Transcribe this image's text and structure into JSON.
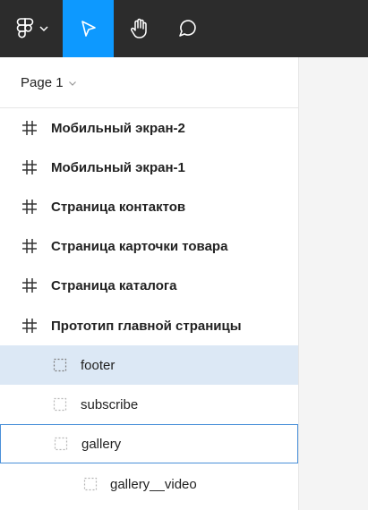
{
  "toolbar": {
    "tools": [
      {
        "icon": "figma-logo-icon",
        "active": false
      },
      {
        "icon": "move-cursor-icon",
        "active": true
      },
      {
        "icon": "hand-icon",
        "active": false
      },
      {
        "icon": "comment-icon",
        "active": false
      }
    ]
  },
  "page": {
    "label": "Page 1"
  },
  "layers": [
    {
      "label": "Мобильный экран-2",
      "type": "frame"
    },
    {
      "label": "Мобильный экран-1",
      "type": "frame"
    },
    {
      "label": "Страница контактов",
      "type": "frame"
    },
    {
      "label": "Страница карточки товара",
      "type": "frame"
    },
    {
      "label": "Страница каталога",
      "type": "frame"
    },
    {
      "label": "Прототип главной страницы",
      "type": "frame"
    },
    {
      "label": "footer",
      "type": "group",
      "state": "selected"
    },
    {
      "label": "subscribe",
      "type": "group"
    },
    {
      "label": "gallery",
      "type": "group",
      "state": "hovered"
    },
    {
      "label": "gallery__video",
      "type": "group"
    }
  ],
  "colors": {
    "toolbar_bg": "#2c2c2c",
    "accent": "#0d99ff",
    "selection": "#dce8f5",
    "hover_border": "#4a90d9"
  }
}
